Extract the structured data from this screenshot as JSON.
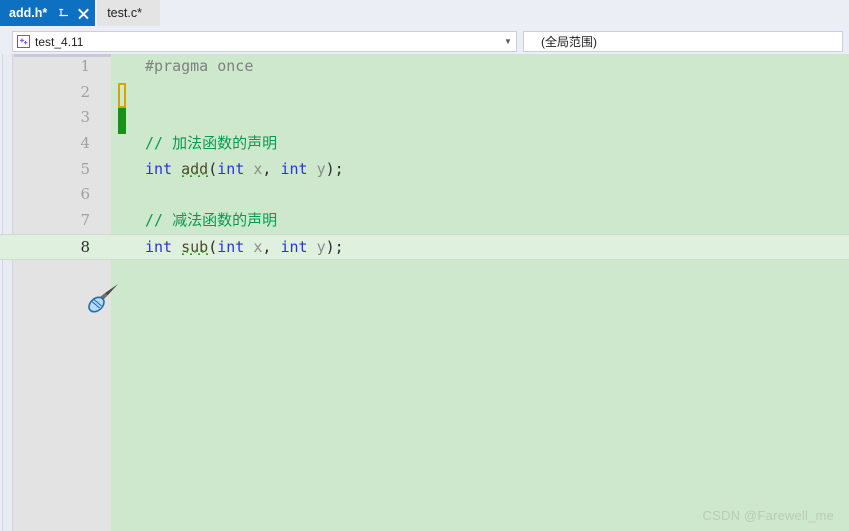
{
  "window": {
    "accent_color": "#0e70c0",
    "chrome_bg": "#eceef5"
  },
  "tabs": [
    {
      "label": "add.h*",
      "active": true,
      "pin_icon": "pin-icon",
      "close_icon": "close-icon"
    },
    {
      "label": "test.c*",
      "active": false
    }
  ],
  "nav_bar": {
    "project_combo": {
      "icon": "cpp-project-icon",
      "value": "test_4.11",
      "arrow_icon": "chevron-down-icon"
    },
    "scope_combo": {
      "value": "(全局范围)"
    }
  },
  "editor": {
    "background_color": "#cde8cd",
    "current_line": 8,
    "current_line_color": "#dff0df",
    "change_bar": {
      "unsaved_line": 2,
      "unsaved_color": "#d8a400",
      "saved_line": 3,
      "saved_color": "#1a8f1a"
    },
    "lines": [
      {
        "num": "1",
        "tokens": [
          {
            "text": "#pragma once",
            "cls": "t-pre"
          }
        ]
      },
      {
        "num": "2",
        "tokens": []
      },
      {
        "num": "3",
        "tokens": []
      },
      {
        "num": "4",
        "tokens": [
          {
            "text": "// 加法函数的声明",
            "cls": "t-cmt"
          }
        ]
      },
      {
        "num": "5",
        "tokens": [
          {
            "text": "int ",
            "cls": "t-kw"
          },
          {
            "text": "add",
            "cls": "t-fn",
            "squiggle": true
          },
          {
            "text": "(",
            "cls": "t-punct"
          },
          {
            "text": "int ",
            "cls": "t-kw"
          },
          {
            "text": "x",
            "cls": "t-id"
          },
          {
            "text": ", ",
            "cls": "t-punct"
          },
          {
            "text": "int ",
            "cls": "t-kw"
          },
          {
            "text": "y",
            "cls": "t-id"
          },
          {
            "text": ");",
            "cls": "t-punct"
          }
        ]
      },
      {
        "num": "6",
        "tokens": []
      },
      {
        "num": "7",
        "tokens": [
          {
            "text": "// 减法函数的声明",
            "cls": "t-cmt"
          }
        ]
      },
      {
        "num": "8",
        "tokens": [
          {
            "text": "int ",
            "cls": "t-kw"
          },
          {
            "text": "sub",
            "cls": "t-fn",
            "squiggle": true
          },
          {
            "text": "(",
            "cls": "t-punct"
          },
          {
            "text": "int ",
            "cls": "t-kw"
          },
          {
            "text": "x",
            "cls": "t-id"
          },
          {
            "text": ", ",
            "cls": "t-punct"
          },
          {
            "text": "int ",
            "cls": "t-kw"
          },
          {
            "text": "y",
            "cls": "t-id"
          },
          {
            "text": ");",
            "cls": "t-punct"
          }
        ]
      }
    ]
  },
  "cursor": {
    "icon": "mouse-cursor-icon",
    "line": 8
  },
  "watermark": {
    "text": "CSDN @Farewell_me"
  }
}
